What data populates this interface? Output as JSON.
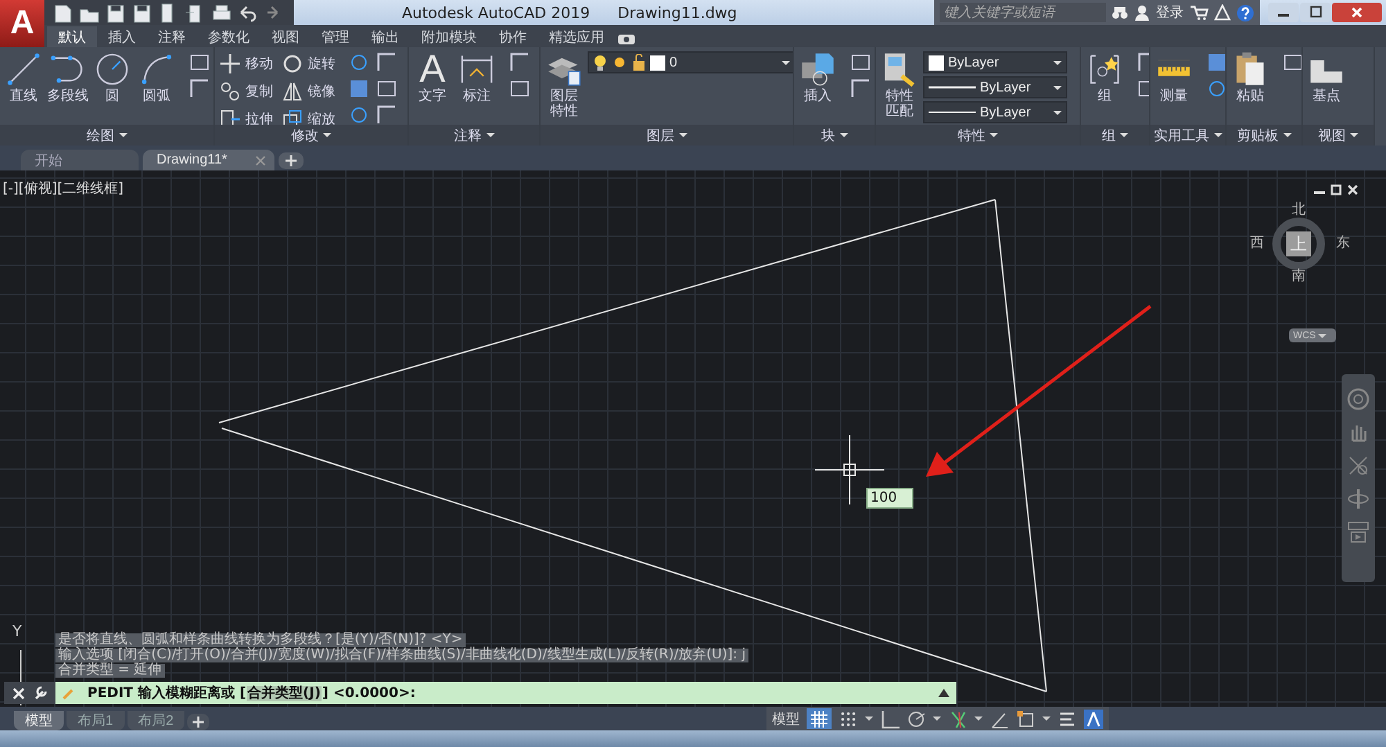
{
  "title_bar": {
    "app_button": "A",
    "title": "Autodesk AutoCAD 2019",
    "file_name": "Drawing11.dwg",
    "search": {
      "placeholder": "键入关键字或短语"
    },
    "sign_in": "登录"
  },
  "ribbon_tabs": [
    {
      "label": "默认",
      "selected": true
    },
    {
      "label": "插入",
      "selected": false
    },
    {
      "label": "注释",
      "selected": false
    },
    {
      "label": "参数化",
      "selected": false
    },
    {
      "label": "视图",
      "selected": false
    },
    {
      "label": "管理",
      "selected": false
    },
    {
      "label": "输出",
      "selected": false
    },
    {
      "label": "附加模块",
      "selected": false
    },
    {
      "label": "协作",
      "selected": false
    },
    {
      "label": "精选应用",
      "selected": false
    }
  ],
  "ribbon_panels": [
    {
      "title": "绘图",
      "tools": [
        {
          "kind": "large",
          "label": "直线"
        },
        {
          "kind": "large",
          "label": "多段线"
        },
        {
          "kind": "large",
          "label": "圆"
        },
        {
          "kind": "large",
          "label": "圆弧"
        }
      ]
    },
    {
      "title": "修改",
      "tools": [
        {
          "kind": "small",
          "label": "移动"
        },
        {
          "kind": "small",
          "label": "旋转"
        },
        {
          "kind": "small",
          "label": "复制"
        },
        {
          "kind": "small",
          "label": "镜像"
        },
        {
          "kind": "small",
          "label": "拉伸"
        },
        {
          "kind": "small",
          "label": "缩放"
        }
      ]
    },
    {
      "title": "注释",
      "tools": [
        {
          "kind": "large",
          "label": "文字",
          "glyph": "A"
        },
        {
          "kind": "large",
          "label": "标注"
        }
      ]
    },
    {
      "title": "图层",
      "tools": [
        {
          "kind": "large",
          "label": "图层特性"
        },
        {
          "kind": "dropdown",
          "label": "0"
        }
      ]
    },
    {
      "title": "块",
      "tools": [
        {
          "kind": "large",
          "label": "插入"
        }
      ]
    },
    {
      "title": "特性",
      "tools": [
        {
          "kind": "large",
          "label": "特性匹配"
        },
        {
          "kind": "dropdown",
          "label": "ByLayer"
        },
        {
          "kind": "dropdown",
          "label": "ByLayer"
        },
        {
          "kind": "dropdown",
          "label": "ByLayer"
        }
      ]
    },
    {
      "title": "组",
      "tools": [
        {
          "kind": "large",
          "label": "组"
        }
      ]
    },
    {
      "title": "实用工具",
      "tools": [
        {
          "kind": "large",
          "label": "测量"
        }
      ]
    },
    {
      "title": "剪贴板",
      "tools": [
        {
          "kind": "large",
          "label": "粘贴"
        }
      ]
    },
    {
      "title": "视图",
      "tools": [
        {
          "kind": "large",
          "label": "基点"
        }
      ]
    }
  ],
  "file_tabs": [
    {
      "label": "开始",
      "selected": false
    },
    {
      "label": "Drawing11*",
      "selected": true
    }
  ],
  "viewport": {
    "label": "[-][俯视][二维线框]",
    "dynamic_input": "100",
    "ucs_label": "Y"
  },
  "view_cube": {
    "north": "北",
    "west": "西",
    "top": "上",
    "east": "东",
    "south": "南",
    "coordinate_system": "WCS"
  },
  "command_history": [
    "是否将直线、圆弧和样条曲线转换为多段线？[是(Y)/否(N)]? <Y>",
    "输入选项 [闭合(C)/打开(O)/合并(J)/宽度(W)/拟合(F)/样条曲线(S)/非曲线化(D)/线型生成(L)/反转(R)/放弃(U)]: j",
    "合并类型 = 延伸"
  ],
  "command_line": {
    "prefix": "PEDIT 输入模糊距离或 [",
    "option": "合并类型(J)",
    "suffix": "] <0.0000>:"
  },
  "layout_tabs": [
    {
      "label": "模型",
      "selected": true
    },
    {
      "label": "布局1",
      "selected": false
    },
    {
      "label": "布局2",
      "selected": false
    }
  ],
  "status_bar": {
    "space": "模型",
    "grid_on": true
  }
}
